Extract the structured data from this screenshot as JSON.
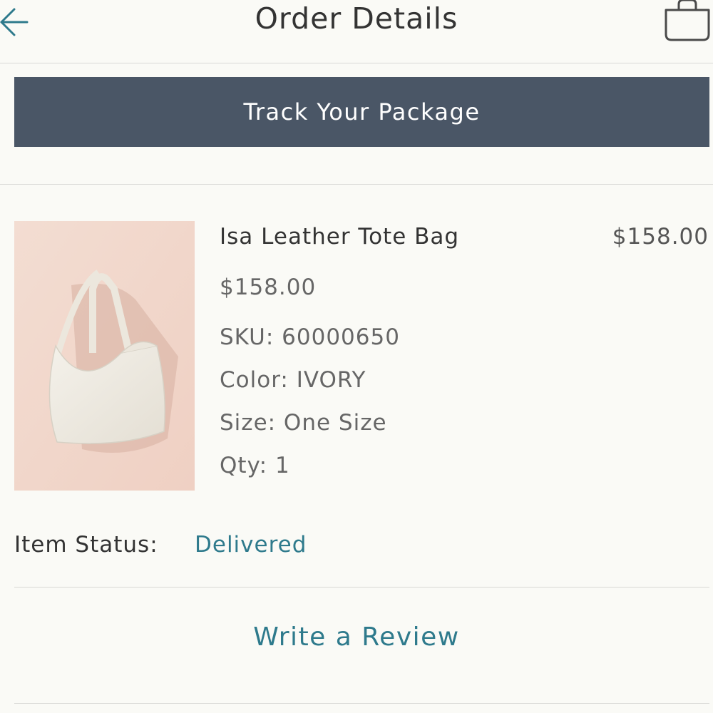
{
  "header": {
    "title": "Order Details",
    "back_icon": "arrow-left-icon",
    "bag_icon": "shopping-bag-icon"
  },
  "track_button": {
    "label": "Track Your Package"
  },
  "item": {
    "name": "Isa Leather Tote Bag",
    "total": "$158.00",
    "price": "$158.00",
    "sku": "SKU: 60000650",
    "color": "Color: IVORY",
    "size": "Size: One Size",
    "qty": "Qty: 1",
    "image": "ivory-tote-bag-photo"
  },
  "status": {
    "label": "Item Status:",
    "value": "Delivered"
  },
  "review_link": {
    "label": "Write a Review"
  },
  "colors": {
    "accent": "#2e7a8c",
    "button_bg": "#4a5666",
    "background": "#fafaf6"
  }
}
